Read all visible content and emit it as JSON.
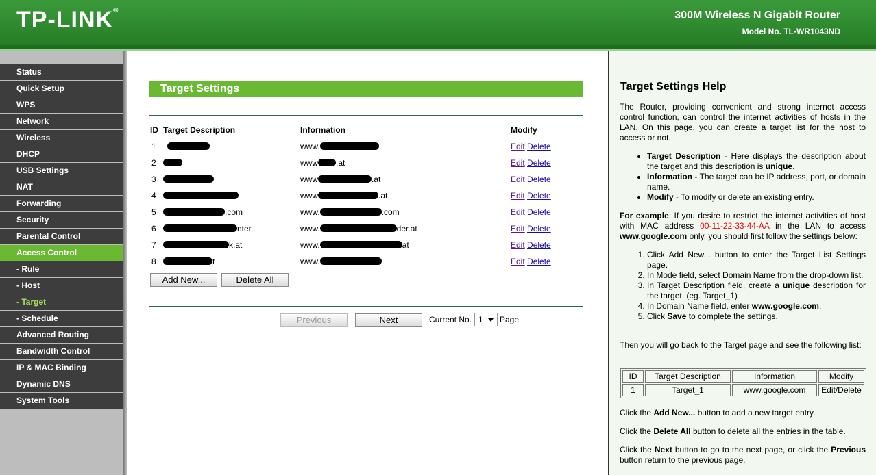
{
  "header": {
    "logo": "TP-LINK",
    "logo_mark": "®",
    "product": "300M Wireless N Gigabit Router",
    "model": "Model No. TL-WR1043ND"
  },
  "menu": [
    {
      "label": "Status"
    },
    {
      "label": "Quick Setup"
    },
    {
      "label": "WPS"
    },
    {
      "label": "Network"
    },
    {
      "label": "Wireless"
    },
    {
      "label": "DHCP"
    },
    {
      "label": "USB Settings"
    },
    {
      "label": "NAT"
    },
    {
      "label": "Forwarding"
    },
    {
      "label": "Security"
    },
    {
      "label": "Parental Control"
    },
    {
      "label": "Access Control"
    },
    {
      "label": "- Rule"
    },
    {
      "label": "- Host"
    },
    {
      "label": "- Target"
    },
    {
      "label": "- Schedule"
    },
    {
      "label": "Advanced Routing"
    },
    {
      "label": "Bandwidth Control"
    },
    {
      "label": "IP & MAC Binding"
    },
    {
      "label": "Dynamic DNS"
    },
    {
      "label": "System Tools"
    }
  ],
  "content": {
    "title": "Target Settings",
    "columns": {
      "id": "ID",
      "desc": "Target Description",
      "info": "Information",
      "modify": "Modify"
    },
    "rows": [
      {
        "id": "1",
        "desc_pre": "",
        "desc_post": "",
        "info_pre": "www.",
        "info_post": ""
      },
      {
        "id": "2",
        "desc_pre": "",
        "desc_post": "",
        "info_pre": "www",
        "info_post": ".at"
      },
      {
        "id": "3",
        "desc_pre": "",
        "desc_post": "",
        "info_pre": "www",
        "info_post": ".at"
      },
      {
        "id": "4",
        "desc_pre": "",
        "desc_post": "",
        "info_pre": "www",
        "info_post": ".at"
      },
      {
        "id": "5",
        "desc_pre": "",
        "desc_post": ".com",
        "info_pre": "www.",
        "info_post": ".com"
      },
      {
        "id": "6",
        "desc_pre": "",
        "desc_post": "nter.",
        "info_pre": "www.",
        "info_post": "der.at"
      },
      {
        "id": "7",
        "desc_pre": "",
        "desc_post": "k.at",
        "info_pre": "www.",
        "info_post": "at"
      },
      {
        "id": "8",
        "desc_pre": "",
        "desc_post": "t",
        "info_pre": "www.",
        "info_post": ""
      }
    ],
    "edit_label": "Edit",
    "delete_label": "Delete",
    "add_new_label": "Add New...",
    "delete_all_label": "Delete All",
    "previous_label": "Previous",
    "next_label": "Next",
    "current_no_label": "Current No.",
    "current_no_value": "1",
    "page_label": "Page"
  },
  "help": {
    "title": "Target Settings Help",
    "intro": "The Router, providing convenient and strong internet access control function, can control the internet activities of hosts in the LAN. On this page, you can create a target list for the host to access or not.",
    "bullets": [
      {
        "term": "Target Description",
        "text": " - Here displays the description about the target and this description is ",
        "bold_end": "unique",
        "end": "."
      },
      {
        "term": "Information",
        "text": " - The target can be IP address, port, or domain name.",
        "bold_end": "",
        "end": ""
      },
      {
        "term": "Modify",
        "text": " - To modify or delete an existing entry.",
        "bold_end": "",
        "end": ""
      }
    ],
    "example_lead": "For example",
    "example_a": ": If you desire to restrict the internet activities of host with MAC address ",
    "example_mac": "00-11-22-33-44-AA",
    "example_b": " in the LAN to access ",
    "example_domain": "www.google.com",
    "example_c": " only, you should first follow the settings below:",
    "steps": {
      "s1": "Click Add New... button to enter the Target List Settings page.",
      "s2": "In Mode field, select Domain Name from the drop-down list.",
      "s3a": "In Target Description field, create a ",
      "s3b": "unique",
      "s3c": " description for the target. (eg. Target_1)",
      "s4a": "In Domain Name field, enter ",
      "s4b": "www.google.com",
      "s4c": ".",
      "s5a": "Click ",
      "s5b": "Save",
      "s5c": " to complete the settings."
    },
    "then_text": "Then you will go back to the Target page and see the following list:",
    "table_headers": [
      "ID",
      "Target Description",
      "Information",
      "Modify"
    ],
    "table_row": [
      "1",
      "Target_1",
      "www.google.com",
      "Edit/Delete"
    ],
    "add_a": "Click the ",
    "add_b": "Add New...",
    "add_c": " button to add a new target entry.",
    "del_a": "Click the ",
    "del_b": "Delete All",
    "del_c": " button to delete all the entries in the table.",
    "next_a": "Click the ",
    "next_b": "Next",
    "next_c": " button to go to the next page, or click the ",
    "next_d": "Previous",
    "next_e": " button return to the previous page."
  }
}
